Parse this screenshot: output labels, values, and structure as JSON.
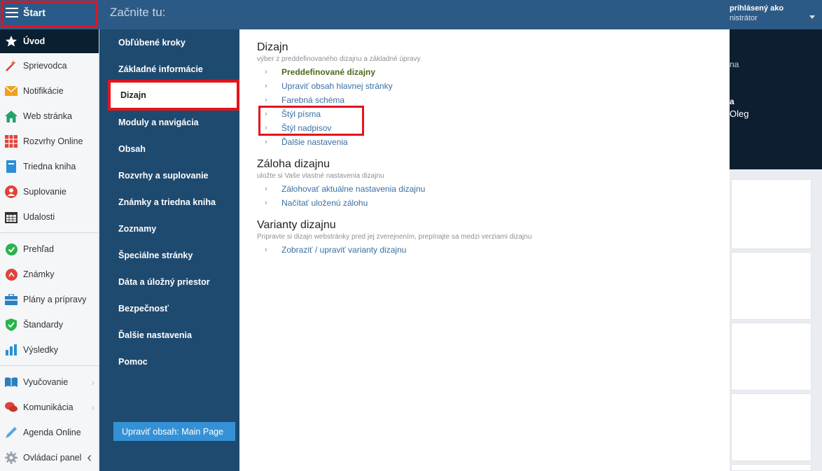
{
  "sidebar": {
    "start_label": "Štart",
    "items": [
      {
        "label": "Úvod",
        "icon": "star-icon"
      },
      {
        "label": "Sprievodca",
        "icon": "wand-icon"
      },
      {
        "label": "Notifikácie",
        "icon": "envelope-icon"
      },
      {
        "label": "Web stránka",
        "icon": "home-icon"
      },
      {
        "label": "Rozvrhy Online",
        "icon": "grid-icon"
      },
      {
        "label": "Triedna kniha",
        "icon": "book-icon"
      },
      {
        "label": "Suplovanie",
        "icon": "person-icon"
      },
      {
        "label": "Udalosti",
        "icon": "calendar-icon"
      },
      {
        "label": "Prehľad",
        "icon": "check-circle-icon"
      },
      {
        "label": "Známky",
        "icon": "grade-icon"
      },
      {
        "label": "Plány a prípravy",
        "icon": "briefcase-icon"
      },
      {
        "label": "Štandardy",
        "icon": "shield-check-icon"
      },
      {
        "label": "Výsledky",
        "icon": "bar-chart-icon"
      },
      {
        "label": "Vyučovanie",
        "icon": "open-book-icon"
      },
      {
        "label": "Komunikácia",
        "icon": "chat-icon"
      },
      {
        "label": "Agenda Online",
        "icon": "pen-icon"
      },
      {
        "label": "Ovládací panel",
        "icon": "gear-icon"
      }
    ]
  },
  "menu": {
    "header_title": "Začnite tu:",
    "categories": [
      "Obľúbené kroky",
      "Základné informácie",
      "Dizajn",
      "Moduly a navigácia",
      "Obsah",
      "Rozvrhy a suplovanie",
      "Známky a triedna kniha",
      "Zoznamy",
      "Špeciálne stránky",
      "Dáta a úložný priestor",
      "Bezpečnosť",
      "Ďalšie nastavenia",
      "Pomoc"
    ],
    "edit_button": "Upraviť obsah: Main Page"
  },
  "content": {
    "sections": [
      {
        "title": "Dizajn",
        "subtitle": "výber z preddefinovaného dizajnu a základné úpravy",
        "links": [
          "Preddefinované dizajny",
          "Upraviť obsah hlavnej stránky",
          "Farebná schéma",
          "Štýl písma",
          "Štýl nadpisov",
          "Ďalšie nastavenia"
        ]
      },
      {
        "title": "Záloha dizajnu",
        "subtitle": "uložte si Vaše vlastné nastavenia dizajnu",
        "links": [
          "Zálohovať aktuálne nastavenia dizajnu",
          "Načítať uloženú zálohu"
        ]
      },
      {
        "title": "Varianty dizajnu",
        "subtitle": "Pripravte si dizajn webstránky pred jej zverejnením, prepínajte sa medzi verziami dizajnu",
        "links": [
          "Zobraziť / upraviť varianty dizajnu"
        ]
      }
    ]
  },
  "account": {
    "line1": "prihlásený ako",
    "line2": "nistrátor"
  },
  "background": {
    "text1": "na",
    "text2": "a",
    "text3": "Oleg"
  },
  "colors": {
    "accent_blue": "#2c5a86",
    "highlight_red": "#e3141d",
    "link_blue": "#3a6fa2",
    "active_green": "#4a6b1e"
  }
}
